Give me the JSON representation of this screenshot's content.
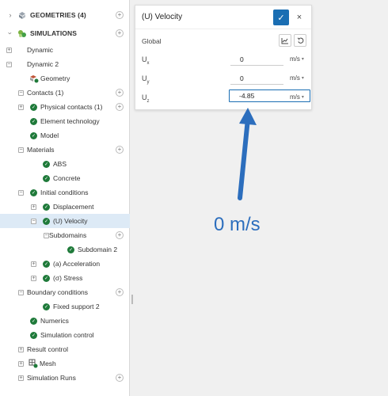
{
  "tree": {
    "items": [
      {
        "label": "GEOMETRIES (4)",
        "kind": "section"
      },
      {
        "label": "SIMULATIONS",
        "kind": "section"
      },
      {
        "label": "Dynamic"
      },
      {
        "label": "Dynamic 2"
      },
      {
        "label": "Geometry"
      },
      {
        "label": "Contacts (1)"
      },
      {
        "label": "Physical contacts (1)"
      },
      {
        "label": "Element technology"
      },
      {
        "label": "Model"
      },
      {
        "label": "Materials"
      },
      {
        "label": "ABS"
      },
      {
        "label": "Concrete"
      },
      {
        "label": "Initial conditions"
      },
      {
        "label": "Displacement"
      },
      {
        "label": "(U) Velocity"
      },
      {
        "label": "Subdomains"
      },
      {
        "label": "Subdomain 2"
      },
      {
        "label": "(a) Acceleration"
      },
      {
        "label": "(σ) Stress"
      },
      {
        "label": "Boundary conditions"
      },
      {
        "label": "Fixed support 2"
      },
      {
        "label": "Numerics"
      },
      {
        "label": "Simulation control"
      },
      {
        "label": "Result control"
      },
      {
        "label": "Mesh"
      },
      {
        "label": "Simulation Runs"
      }
    ]
  },
  "panel": {
    "title": "(U) Velocity",
    "global_label": "Global",
    "fields": [
      {
        "label": "U",
        "sub": "x",
        "value": "0",
        "unit": "m/s"
      },
      {
        "label": "U",
        "sub": "y",
        "value": "0",
        "unit": "m/s"
      },
      {
        "label": "U",
        "sub": "z",
        "value": "-4.85",
        "unit": "m/s"
      }
    ]
  },
  "annotation": {
    "text": "0 m/s",
    "color": "#2c6ebd"
  },
  "colors": {
    "accent": "#1a6eb3",
    "check": "#1f7a3a",
    "selected_row": "#ddeaf6"
  }
}
